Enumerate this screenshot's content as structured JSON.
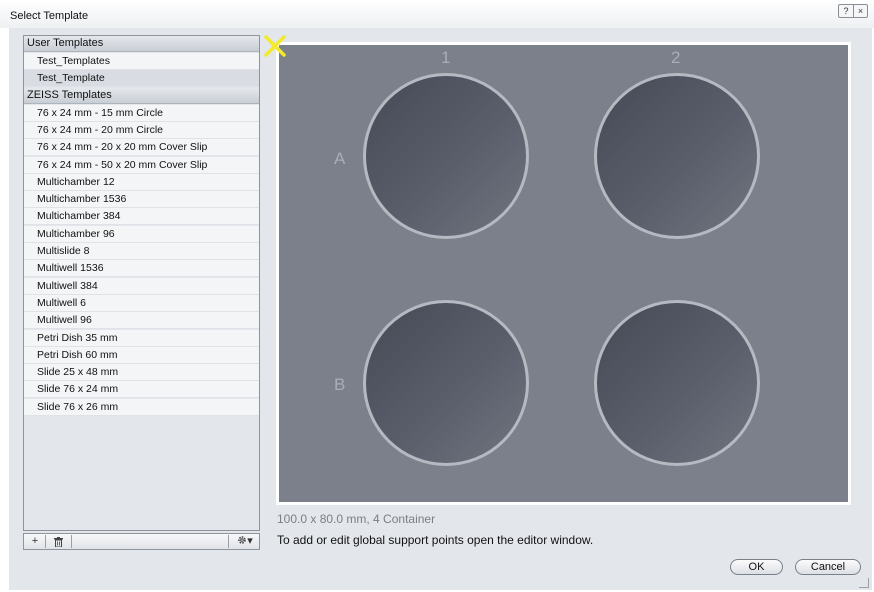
{
  "window": {
    "title": "Select Template",
    "help_label": "?",
    "close_label": "×"
  },
  "tree": {
    "groups": [
      {
        "header": "User Templates",
        "items": [
          {
            "label": "Test_Templates",
            "selected": false
          },
          {
            "label": "Test_Template",
            "selected": true
          }
        ]
      },
      {
        "header": "ZEISS Templates",
        "items": [
          {
            "label": "76 x 24 mm - 15 mm Circle"
          },
          {
            "label": "76 x 24 mm - 20 mm Circle"
          },
          {
            "label": "76 x 24 mm - 20 x 20 mm Cover Slip"
          },
          {
            "label": "76 x 24 mm - 50 x 20 mm Cover Slip"
          },
          {
            "label": "Multichamber 12"
          },
          {
            "label": "Multichamber 1536"
          },
          {
            "label": "Multichamber 384"
          },
          {
            "label": "Multichamber 96"
          },
          {
            "label": "Multislide 8"
          },
          {
            "label": "Multiwell 1536"
          },
          {
            "label": "Multiwell 384"
          },
          {
            "label": "Multiwell 6"
          },
          {
            "label": "Multiwell 96"
          },
          {
            "label": "Petri Dish 35 mm"
          },
          {
            "label": "Petri Dish 60 mm"
          },
          {
            "label": "Slide 25 x 48 mm"
          },
          {
            "label": "Slide 76 x 24 mm"
          },
          {
            "label": "Slide 76 x 26 mm"
          }
        ]
      }
    ],
    "toolbar": {
      "add_label": "+",
      "delete_icon": "trash-icon",
      "options_icon": "gear-icon",
      "options_arrow": "▾"
    }
  },
  "preview": {
    "column_labels": [
      "1",
      "2"
    ],
    "row_labels": [
      "A",
      "B"
    ],
    "info": "100.0 x 80.0 mm, 4 Container",
    "hint": "To add or edit global support points open the editor window.",
    "marker_icon": "crosshair-x-icon",
    "colors": {
      "plate": "#7c808b",
      "well_border": "#b5b9c1",
      "marker": "#f2ea2a"
    }
  },
  "buttons": {
    "ok": "OK",
    "cancel": "Cancel"
  }
}
